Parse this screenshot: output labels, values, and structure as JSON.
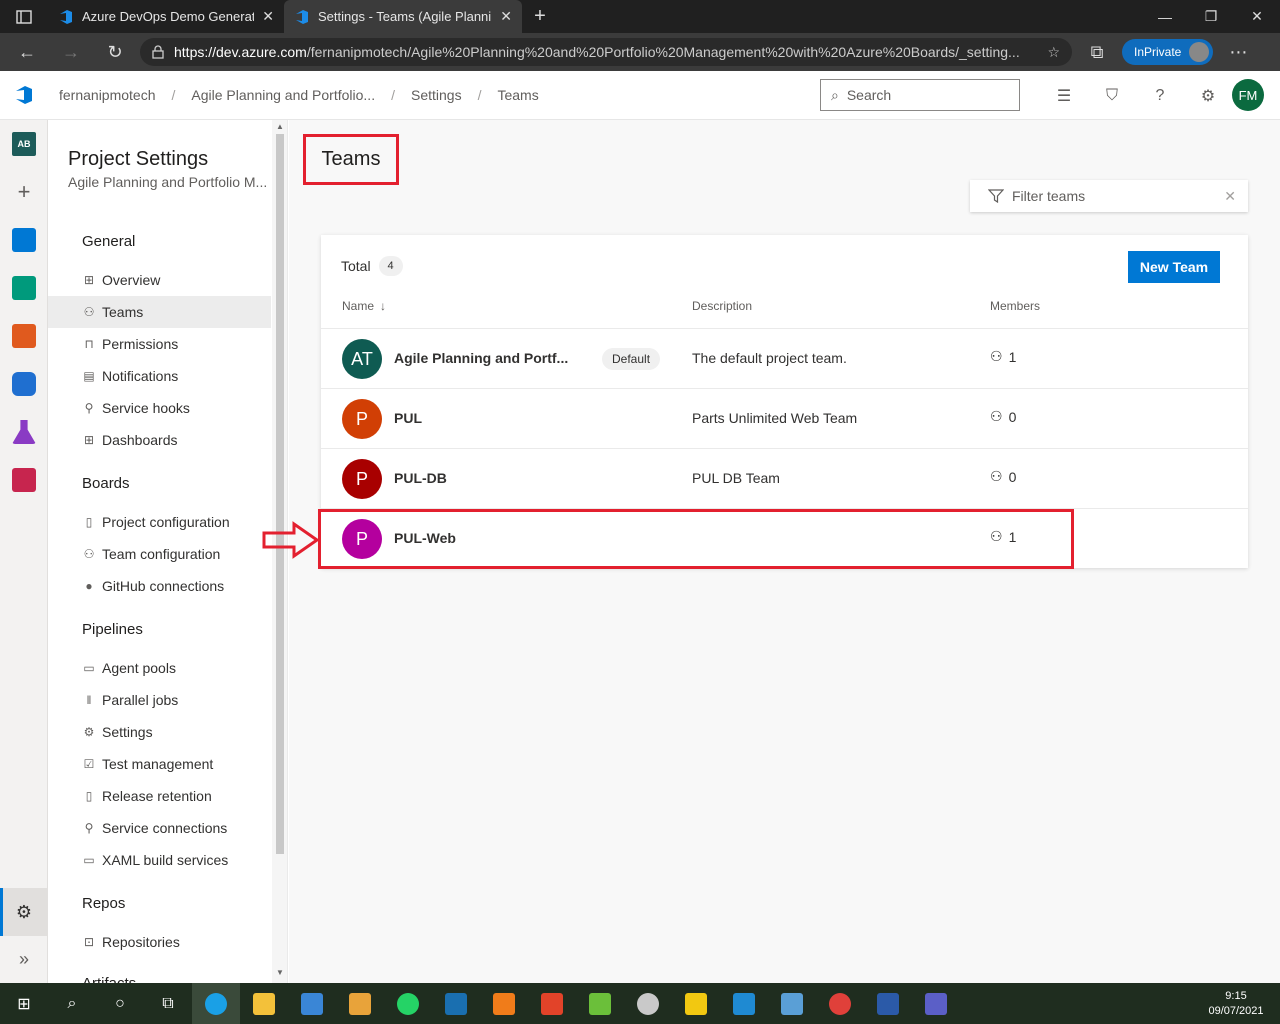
{
  "browser": {
    "tabs": [
      {
        "title": "Azure DevOps Demo Generator",
        "active": false
      },
      {
        "title": "Settings - Teams (Agile Planning",
        "active": true
      }
    ],
    "url_host": "https://dev.azure.com",
    "url_path": "/fernanipmotech/Agile%20Planning%20and%20Portfolio%20Management%20with%20Azure%20Boards/_setting...",
    "inprivate_label": "InPrivate"
  },
  "header": {
    "breadcrumbs": [
      "fernanipmotech",
      "Agile Planning and Portfolio...",
      "Settings",
      "Teams"
    ],
    "search_placeholder": "Search",
    "user_initials": "FM",
    "user_color": "#0b6a3f"
  },
  "rail": {
    "project_initials": "AB",
    "items": [
      {
        "name": "overview-icon",
        "color": "#1d5c5a"
      },
      {
        "name": "add-icon"
      },
      {
        "name": "boards-icon",
        "color": "#0078d4"
      },
      {
        "name": "repos-icon",
        "color": "#e05a1e"
      },
      {
        "name": "pipelines-icon",
        "color": "#1f6fd0"
      },
      {
        "name": "test-plans-icon",
        "color": "#8a3bc4"
      },
      {
        "name": "artifacts-icon",
        "color": "#c7254e"
      }
    ]
  },
  "sidebar": {
    "title": "Project Settings",
    "subtitle": "Agile Planning and Portfolio M...",
    "sections": {
      "general": "General",
      "boards": "Boards",
      "pipelines": "Pipelines",
      "repos": "Repos",
      "artifacts": "Artifacts"
    },
    "general_items": [
      {
        "label": "Overview",
        "icon": "overview-icon"
      },
      {
        "label": "Teams",
        "icon": "teams-icon",
        "selected": true
      },
      {
        "label": "Permissions",
        "icon": "lock-icon"
      },
      {
        "label": "Notifications",
        "icon": "notifications-icon"
      },
      {
        "label": "Service hooks",
        "icon": "plug-icon"
      },
      {
        "label": "Dashboards",
        "icon": "dashboards-icon"
      }
    ],
    "boards_items": [
      {
        "label": "Project configuration",
        "icon": "document-icon"
      },
      {
        "label": "Team configuration",
        "icon": "team-config-icon"
      },
      {
        "label": "GitHub connections",
        "icon": "github-icon"
      }
    ],
    "pipelines_items": [
      {
        "label": "Agent pools",
        "icon": "agent-pool-icon"
      },
      {
        "label": "Parallel jobs",
        "icon": "parallel-icon"
      },
      {
        "label": "Settings",
        "icon": "gear-icon"
      },
      {
        "label": "Test management",
        "icon": "test-icon"
      },
      {
        "label": "Release retention",
        "icon": "retention-icon"
      },
      {
        "label": "Service connections",
        "icon": "plug-icon"
      },
      {
        "label": "XAML build services",
        "icon": "build-icon"
      }
    ],
    "repos_items": [
      {
        "label": "Repositories",
        "icon": "repo-icon"
      }
    ]
  },
  "main": {
    "page_title": "Teams",
    "filter_placeholder": "Filter teams",
    "total_label": "Total",
    "total_count": "4",
    "new_team_label": "New Team",
    "columns": {
      "name": "Name",
      "description": "Description",
      "members": "Members"
    },
    "teams": [
      {
        "initials": "AT",
        "name": "Agile Planning and Portf...",
        "default_badge": "Default",
        "description": "The default project team.",
        "members": "1",
        "color": "#0f5b52"
      },
      {
        "initials": "P",
        "name": "PUL",
        "default_badge": "",
        "description": "Parts Unlimited Web Team",
        "members": "0",
        "color": "#d13f05"
      },
      {
        "initials": "P",
        "name": "PUL-DB",
        "default_badge": "",
        "description": "PUL DB Team",
        "members": "0",
        "color": "#a80000"
      },
      {
        "initials": "P",
        "name": "PUL-Web",
        "default_badge": "",
        "description": "",
        "members": "1",
        "color": "#b4009e"
      }
    ],
    "annotation_color": "#e3202f"
  },
  "taskbar": {
    "time": "9:15",
    "date": "09/07/2021"
  }
}
